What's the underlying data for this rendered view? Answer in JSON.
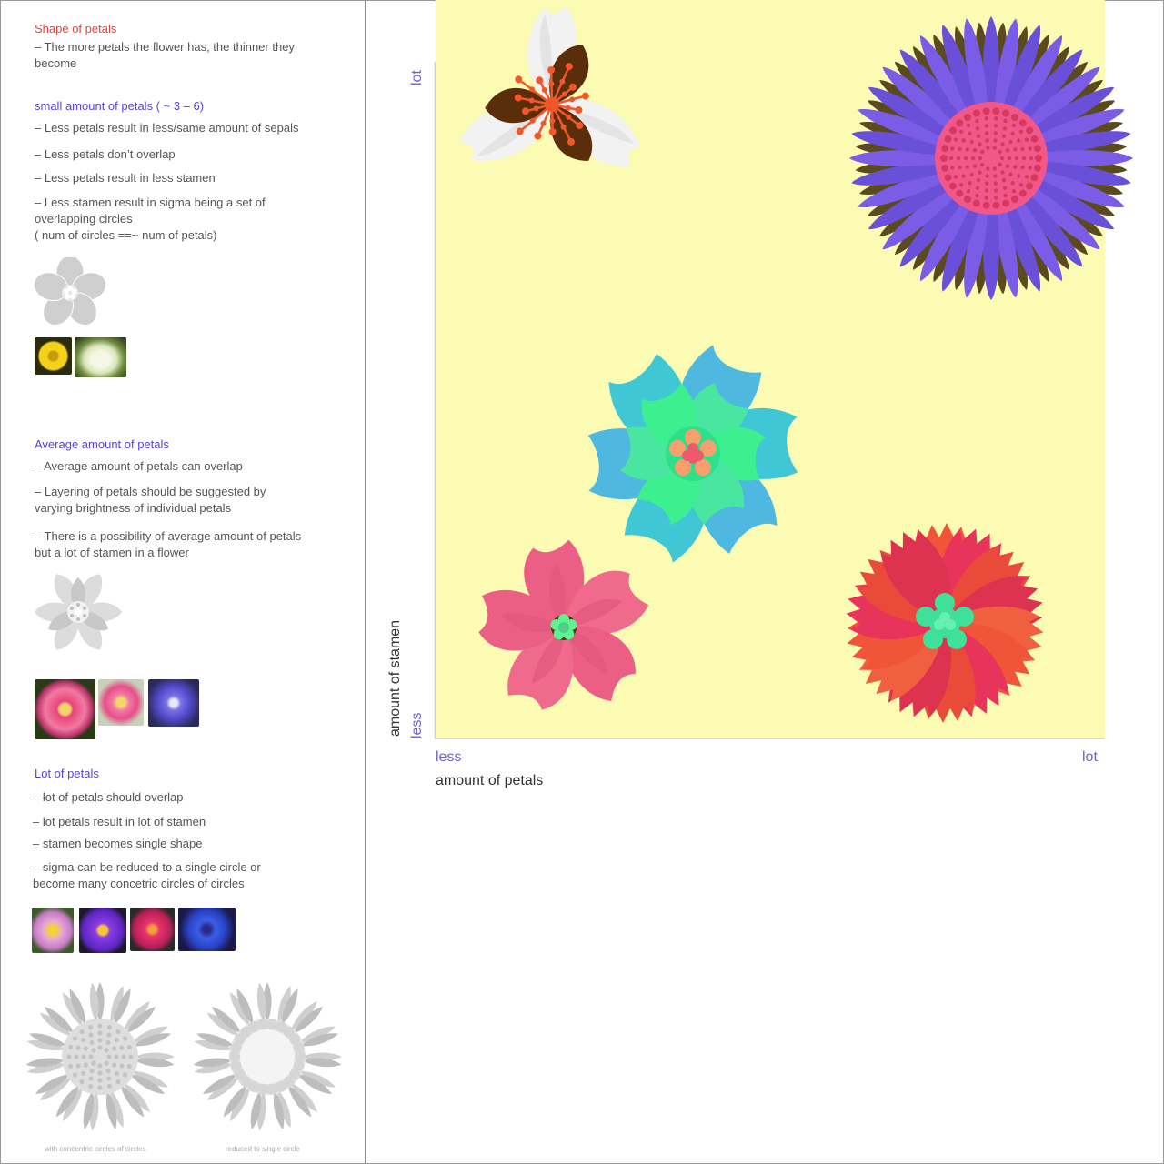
{
  "sidebar": {
    "shape": {
      "heading": "Shape of petals",
      "note": "– The more petals the flower has, the thinner they become"
    },
    "small": {
      "heading": "small amount of petals ( ~ 3 – 6)",
      "notes": [
        "– Less petals result in less/same amount of sepals",
        "– Less petals don’t overlap",
        "– Less petals result in less stamen",
        "– Less stamen result in sigma being a set of overlapping circles",
        "( num of circles ==~ num of petals)"
      ]
    },
    "average": {
      "heading": "Average amount of petals",
      "notes": [
        "– Average amount of petals can overlap",
        "– Layering of petals should be suggested by varying brightness of individual petals",
        "– There is a possibility of average amount of petals but a lot of stamen in a flower"
      ]
    },
    "lot": {
      "heading": "Lot of petals",
      "notes": [
        "– lot of petals should overlap",
        "– lot petals result in lot of stamen",
        "– stamen becomes single shape",
        "– sigma can be reduced to a single circle or become many concetric circles of circles"
      ],
      "captions": [
        "with concentric circles of circles",
        "reduced to single circle"
      ]
    }
  },
  "chart": {
    "x_less": "less",
    "x_lot": "lot",
    "x_title": "amount of petals",
    "y_less": "less",
    "y_lot": "lot",
    "y_title": "amount of stamen",
    "bg_color": "#fbfbb4",
    "accent_color": "#6e62d0"
  },
  "flowers": [
    {
      "name": "lily-flower",
      "petal_colors": [
        "#f2f2f2",
        "#5a2e0a"
      ],
      "center_color": "#f2572a"
    },
    {
      "name": "aster-flower",
      "petal_colors": [
        "#7a5ce6"
      ],
      "center_color": "#f0588a"
    },
    {
      "name": "cyan-green-flower",
      "petal_colors": [
        "#3fc7d6",
        "#3cf08f"
      ],
      "center_color": "#f7a06e"
    },
    {
      "name": "pink-flower",
      "petal_colors": [
        "#f06a8c"
      ],
      "center_color": "#5ff08f"
    },
    {
      "name": "carnation-flower",
      "petal_colors": [
        "#f0553a",
        "#e8345a"
      ],
      "center_color": "#3ee09a"
    }
  ]
}
